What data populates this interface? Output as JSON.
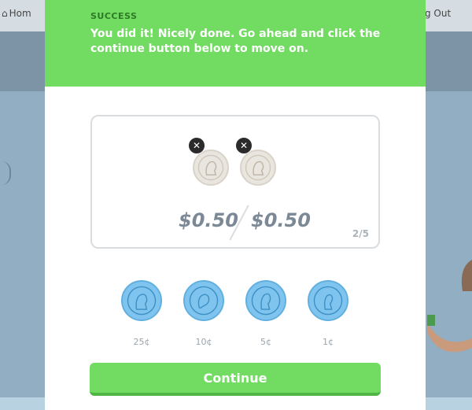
{
  "background": {
    "home_label": "Hom",
    "home_icon": "home-icon",
    "logout_label": "g Out"
  },
  "success": {
    "title": "SUCCESS",
    "message": "You did it! Nicely done. Go ahead and click the continue button below to move on."
  },
  "tray": {
    "coins": [
      {
        "icon": "quarter-coin-icon",
        "remove": "✕"
      },
      {
        "icon": "quarter-coin-icon",
        "remove": "✕"
      }
    ],
    "current_amount": "$0.50",
    "target_amount": "$0.50",
    "progress": "2/5"
  },
  "coin_options": [
    {
      "label": "25¢",
      "icon": "quarter-coin-icon"
    },
    {
      "label": "10¢",
      "icon": "dime-coin-icon"
    },
    {
      "label": "5¢",
      "icon": "nickel-coin-icon"
    },
    {
      "label": "1¢",
      "icon": "penny-coin-icon"
    }
  ],
  "continue_label": "Continue",
  "colors": {
    "success_green": "#72dc62",
    "coin_blue": "#7ec4ee",
    "amount_gray": "#7b8896"
  }
}
